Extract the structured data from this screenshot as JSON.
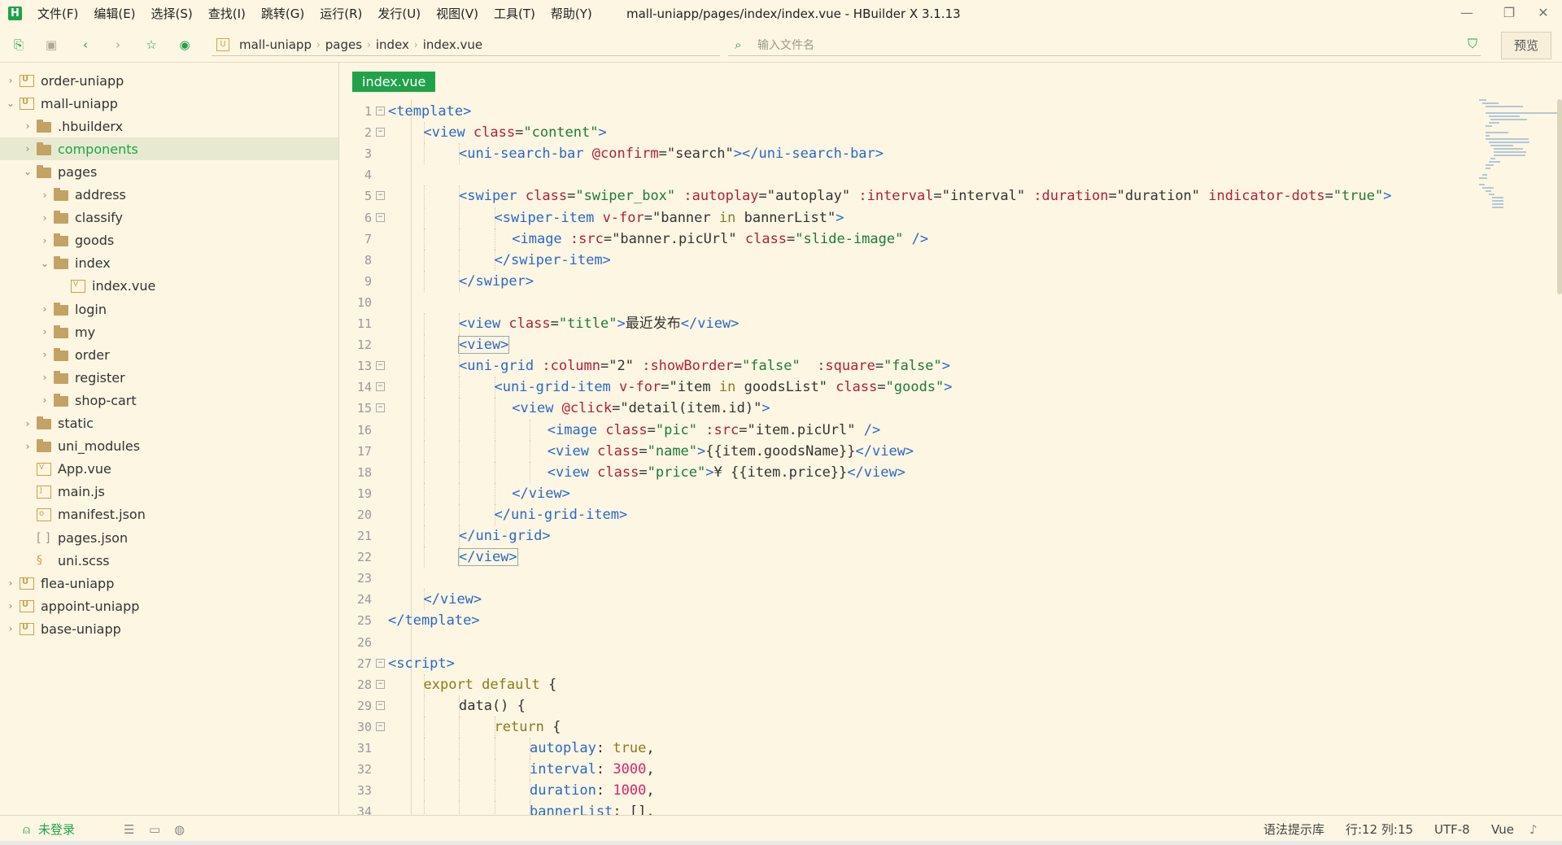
{
  "app": {
    "logo": "H",
    "window_title": "mall-uniapp/pages/index/index.vue - HBuilder X 3.1.13",
    "menu": [
      "文件(F)",
      "编辑(E)",
      "选择(S)",
      "查找(I)",
      "跳转(G)",
      "运行(R)",
      "发行(U)",
      "视图(V)",
      "工具(T)",
      "帮助(Y)"
    ]
  },
  "toolbar": {
    "breadcrumb": [
      "mall-uniapp",
      "pages",
      "index",
      "index.vue"
    ],
    "file_search_placeholder": "输入文件名",
    "preview_label": "预览"
  },
  "sidebar": {
    "items": [
      {
        "label": "order-uniapp",
        "icon": "project-icon",
        "depth": 0,
        "expanded": false
      },
      {
        "label": "mall-uniapp",
        "icon": "project-icon",
        "depth": 0,
        "expanded": true
      },
      {
        "label": ".hbuilderx",
        "icon": "folder-icon",
        "depth": 1,
        "expanded": false
      },
      {
        "label": "components",
        "icon": "folder-icon",
        "depth": 1,
        "expanded": false,
        "selected": true
      },
      {
        "label": "pages",
        "icon": "folder-open-icon",
        "depth": 1,
        "expanded": true
      },
      {
        "label": "address",
        "icon": "folder-icon",
        "depth": 2,
        "expanded": false
      },
      {
        "label": "classify",
        "icon": "folder-icon",
        "depth": 2,
        "expanded": false
      },
      {
        "label": "goods",
        "icon": "folder-icon",
        "depth": 2,
        "expanded": false
      },
      {
        "label": "index",
        "icon": "folder-open-icon",
        "depth": 2,
        "expanded": true
      },
      {
        "label": "index.vue",
        "icon": "vue-file-icon",
        "depth": 3
      },
      {
        "label": "login",
        "icon": "folder-icon",
        "depth": 2,
        "expanded": false
      },
      {
        "label": "my",
        "icon": "folder-icon",
        "depth": 2,
        "expanded": false
      },
      {
        "label": "order",
        "icon": "folder-icon",
        "depth": 2,
        "expanded": false
      },
      {
        "label": "register",
        "icon": "folder-icon",
        "depth": 2,
        "expanded": false
      },
      {
        "label": "shop-cart",
        "icon": "folder-icon",
        "depth": 2,
        "expanded": false
      },
      {
        "label": "static",
        "icon": "folder-icon",
        "depth": 1,
        "expanded": false
      },
      {
        "label": "uni_modules",
        "icon": "folder-icon",
        "depth": 1,
        "expanded": false
      },
      {
        "label": "App.vue",
        "icon": "vue-file-icon",
        "depth": 1
      },
      {
        "label": "main.js",
        "icon": "js-file-icon",
        "depth": 1
      },
      {
        "label": "manifest.json",
        "icon": "json-file-icon",
        "depth": 1
      },
      {
        "label": "pages.json",
        "icon": "bracket-file-icon",
        "depth": 1
      },
      {
        "label": "uni.scss",
        "icon": "scss-file-icon",
        "depth": 1
      },
      {
        "label": "flea-uniapp",
        "icon": "project-icon",
        "depth": 0,
        "expanded": false
      },
      {
        "label": "appoint-uniapp",
        "icon": "project-icon",
        "depth": 0,
        "expanded": false
      },
      {
        "label": "base-uniapp",
        "icon": "project-icon",
        "depth": 0,
        "expanded": false
      }
    ]
  },
  "editor": {
    "tab_label": "index.vue",
    "lines": [
      {
        "n": "1",
        "fold": true,
        "indent": 0,
        "tokens": [
          [
            "t",
            "<template>"
          ]
        ]
      },
      {
        "n": "2",
        "fold": true,
        "indent": 1,
        "tokens": [
          [
            "t",
            "<view "
          ],
          [
            "a",
            "class"
          ],
          [
            "p",
            "="
          ],
          [
            "s",
            "\"content\""
          ],
          [
            "t",
            ">"
          ]
        ]
      },
      {
        "n": "3",
        "fold": false,
        "indent": 2,
        "tokens": [
          [
            "t",
            "<uni-search-bar "
          ],
          [
            "a",
            "@confirm"
          ],
          [
            "p",
            "=\"search\""
          ],
          [
            "t",
            "></uni-search-bar>"
          ]
        ]
      },
      {
        "n": "4",
        "fold": false,
        "indent": 0,
        "tokens": []
      },
      {
        "n": "5",
        "fold": true,
        "indent": 2,
        "tokens": [
          [
            "t",
            "<swiper "
          ],
          [
            "a",
            "class"
          ],
          [
            "p",
            "="
          ],
          [
            "s",
            "\"swiper_box\""
          ],
          [
            "p",
            " "
          ],
          [
            "a",
            ":autoplay"
          ],
          [
            "p",
            "=\"autoplay\" "
          ],
          [
            "a",
            ":interval"
          ],
          [
            "p",
            "=\"interval\" "
          ],
          [
            "a",
            ":duration"
          ],
          [
            "p",
            "=\"duration\" "
          ],
          [
            "a",
            "indicator-dots"
          ],
          [
            "p",
            "="
          ],
          [
            "s",
            "\"true\""
          ],
          [
            "t",
            ">"
          ]
        ]
      },
      {
        "n": "6",
        "fold": true,
        "indent": 3,
        "tokens": [
          [
            "t",
            "<swiper-item "
          ],
          [
            "a",
            "v-for"
          ],
          [
            "p",
            "=\"banner "
          ],
          [
            "k",
            "in"
          ],
          [
            "p",
            " bannerList\""
          ],
          [
            "t",
            ">"
          ]
        ]
      },
      {
        "n": "7",
        "fold": false,
        "indent": 3.5,
        "tokens": [
          [
            "t",
            "<image "
          ],
          [
            "a",
            ":src"
          ],
          [
            "p",
            "=\"banner.picUrl\" "
          ],
          [
            "a",
            "class"
          ],
          [
            "p",
            "="
          ],
          [
            "s",
            "\"slide-image\""
          ],
          [
            "t",
            " />"
          ]
        ]
      },
      {
        "n": "8",
        "fold": false,
        "indent": 3,
        "tokens": [
          [
            "t",
            "</swiper-item>"
          ]
        ]
      },
      {
        "n": "9",
        "fold": false,
        "indent": 2,
        "tokens": [
          [
            "t",
            "</swiper>"
          ]
        ]
      },
      {
        "n": "10",
        "fold": false,
        "indent": 0,
        "tokens": []
      },
      {
        "n": "11",
        "fold": false,
        "indent": 2,
        "tokens": [
          [
            "t",
            "<view "
          ],
          [
            "a",
            "class"
          ],
          [
            "p",
            "="
          ],
          [
            "s",
            "\"title\""
          ],
          [
            "t",
            ">"
          ],
          [
            "p",
            "最近发布"
          ],
          [
            "t",
            "</view>"
          ]
        ]
      },
      {
        "n": "12",
        "fold": false,
        "indent": 2,
        "hl": true,
        "tokens": [
          [
            "t",
            "<view>"
          ]
        ]
      },
      {
        "n": "13",
        "fold": true,
        "indent": 2,
        "tokens": [
          [
            "t",
            "<uni-grid "
          ],
          [
            "a",
            ":column"
          ],
          [
            "p",
            "=\"2\" "
          ],
          [
            "a",
            ":showBorder"
          ],
          [
            "p",
            "="
          ],
          [
            "s",
            "\"false\""
          ],
          [
            "p",
            "  "
          ],
          [
            "a",
            ":square"
          ],
          [
            "p",
            "="
          ],
          [
            "s",
            "\"false\""
          ],
          [
            "t",
            ">"
          ]
        ]
      },
      {
        "n": "14",
        "fold": true,
        "indent": 3,
        "tokens": [
          [
            "t",
            "<uni-grid-item "
          ],
          [
            "a",
            "v-for"
          ],
          [
            "p",
            "=\"item "
          ],
          [
            "k",
            "in"
          ],
          [
            "p",
            " goodsList\" "
          ],
          [
            "a",
            "class"
          ],
          [
            "p",
            "="
          ],
          [
            "s",
            "\"goods\""
          ],
          [
            "t",
            ">"
          ]
        ]
      },
      {
        "n": "15",
        "fold": true,
        "indent": 3.5,
        "tokens": [
          [
            "t",
            "<view "
          ],
          [
            "a",
            "@click"
          ],
          [
            "p",
            "=\"detail(item.id)\""
          ],
          [
            "t",
            ">"
          ]
        ]
      },
      {
        "n": "16",
        "fold": false,
        "indent": 4.5,
        "tokens": [
          [
            "t",
            "<image "
          ],
          [
            "a",
            "class"
          ],
          [
            "p",
            "="
          ],
          [
            "s",
            "\"pic\""
          ],
          [
            "p",
            " "
          ],
          [
            "a",
            ":src"
          ],
          [
            "p",
            "=\"item.picUrl\""
          ],
          [
            "t",
            " />"
          ]
        ]
      },
      {
        "n": "17",
        "fold": false,
        "indent": 4.5,
        "tokens": [
          [
            "t",
            "<view "
          ],
          [
            "a",
            "class"
          ],
          [
            "p",
            "="
          ],
          [
            "s",
            "\"name\""
          ],
          [
            "t",
            ">"
          ],
          [
            "p",
            "{{item.goodsName}}"
          ],
          [
            "t",
            "</view>"
          ]
        ]
      },
      {
        "n": "18",
        "fold": false,
        "indent": 4.5,
        "tokens": [
          [
            "t",
            "<view "
          ],
          [
            "a",
            "class"
          ],
          [
            "p",
            "="
          ],
          [
            "s",
            "\"price\""
          ],
          [
            "t",
            ">"
          ],
          [
            "p",
            "¥ {{item.price}}"
          ],
          [
            "t",
            "</view>"
          ]
        ]
      },
      {
        "n": "19",
        "fold": false,
        "indent": 3.5,
        "tokens": [
          [
            "t",
            "</view>"
          ]
        ]
      },
      {
        "n": "20",
        "fold": false,
        "indent": 3,
        "tokens": [
          [
            "t",
            "</uni-grid-item>"
          ]
        ]
      },
      {
        "n": "21",
        "fold": false,
        "indent": 2,
        "tokens": [
          [
            "t",
            "</uni-grid>"
          ]
        ]
      },
      {
        "n": "22",
        "fold": false,
        "indent": 2,
        "hl": true,
        "tokens": [
          [
            "t",
            "</view>"
          ]
        ]
      },
      {
        "n": "23",
        "fold": false,
        "indent": 0,
        "tokens": []
      },
      {
        "n": "24",
        "fold": false,
        "indent": 1,
        "tokens": [
          [
            "t",
            "</view>"
          ]
        ]
      },
      {
        "n": "25",
        "fold": false,
        "indent": 0,
        "tokens": [
          [
            "t",
            "</template>"
          ]
        ]
      },
      {
        "n": "26",
        "fold": false,
        "indent": 0,
        "tokens": []
      },
      {
        "n": "27",
        "fold": true,
        "indent": 0,
        "tokens": [
          [
            "t",
            "<script>"
          ]
        ]
      },
      {
        "n": "28",
        "fold": true,
        "indent": 1,
        "tokens": [
          [
            "k",
            "export default"
          ],
          [
            "p",
            " {"
          ]
        ]
      },
      {
        "n": "29",
        "fold": true,
        "indent": 2,
        "tokens": [
          [
            "p",
            "data() {"
          ]
        ]
      },
      {
        "n": "30",
        "fold": true,
        "indent": 3,
        "tokens": [
          [
            "k",
            "return"
          ],
          [
            "p",
            " {"
          ]
        ]
      },
      {
        "n": "31",
        "fold": false,
        "indent": 4,
        "tokens": [
          [
            "t",
            "autoplay"
          ],
          [
            "p",
            ": "
          ],
          [
            "k",
            "true"
          ],
          [
            "p",
            ","
          ]
        ]
      },
      {
        "n": "32",
        "fold": false,
        "indent": 4,
        "tokens": [
          [
            "t",
            "interval"
          ],
          [
            "p",
            ": "
          ],
          [
            "n",
            "3000"
          ],
          [
            "p",
            ","
          ]
        ]
      },
      {
        "n": "33",
        "fold": false,
        "indent": 4,
        "tokens": [
          [
            "t",
            "duration"
          ],
          [
            "p",
            ": "
          ],
          [
            "n",
            "1000"
          ],
          [
            "p",
            ","
          ]
        ]
      },
      {
        "n": "34",
        "fold": false,
        "indent": 4,
        "tokens": [
          [
            "t",
            "bannerList"
          ],
          [
            "p",
            ": [],"
          ]
        ]
      }
    ]
  },
  "statusbar": {
    "login": "未登录",
    "syntax_lib": "语法提示库",
    "position": "行:12  列:15",
    "encoding": "UTF-8",
    "language": "Vue"
  }
}
